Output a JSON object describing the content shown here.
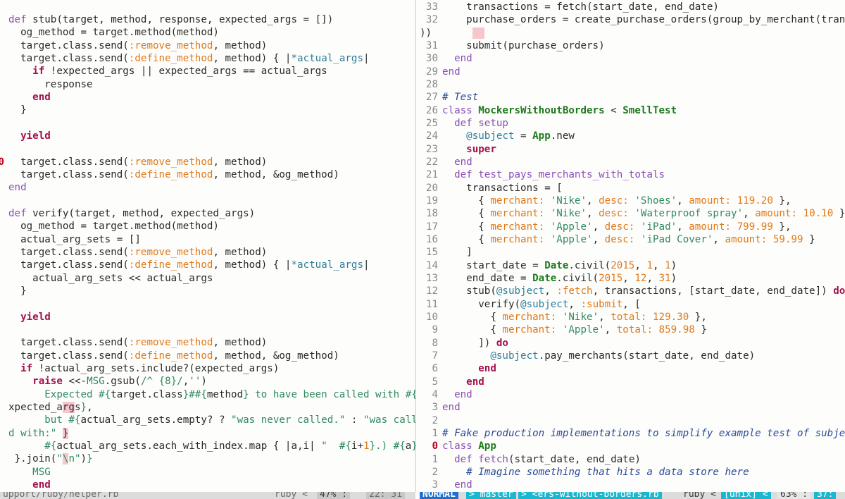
{
  "left_pane": {
    "lines": [
      {
        "n": "",
        "c": "<span class=\"kw\">def</span> stub(target, method, response, expected_args = [])"
      },
      {
        "n": "",
        "c": "  og_method = target.method(method)"
      },
      {
        "n": "",
        "c": "  target.class.send(<span class=\"sym\">:remove_method</span>, method)"
      },
      {
        "n": "",
        "c": "  target.class.send(<span class=\"sym\">:define_method</span>, method) { |<span class=\"ivar\">*actual_args</span>|"
      },
      {
        "n": "",
        "c": "    <span class=\"kwb\">if</span> !expected_args || expected_args == actual_args"
      },
      {
        "n": "",
        "c": "      response"
      },
      {
        "n": "",
        "c": "    <span class=\"kwb\">end</span>"
      },
      {
        "n": "",
        "c": "  }"
      },
      {
        "n": "",
        "c": ""
      },
      {
        "n": "",
        "c": "  <span class=\"kwb\">yield</span>"
      },
      {
        "n": "",
        "c": ""
      },
      {
        "n": "0",
        "cur": true,
        "c": "  target.class.send(<span class=\"sym\">:remove_method</span>, method)"
      },
      {
        "n": "",
        "c": "  target.class.send(<span class=\"sym\">:define_method</span>, method, &amp;og_method)"
      },
      {
        "n": "",
        "c": "<span class=\"kw\">end</span>"
      },
      {
        "n": "",
        "c": ""
      },
      {
        "n": "",
        "c": "<span class=\"kw\">def</span> verify(target, method, expected_args)"
      },
      {
        "n": "",
        "c": "  og_method = target.method(method)"
      },
      {
        "n": "",
        "c": "  actual_arg_sets = []"
      },
      {
        "n": "",
        "c": "  target.class.send(<span class=\"sym\">:remove_method</span>, method)"
      },
      {
        "n": "",
        "c": "  target.class.send(<span class=\"sym\">:define_method</span>, method) { |<span class=\"ivar\">*actual_args</span>|"
      },
      {
        "n": "",
        "c": "    actual_arg_sets &lt;&lt; actual_args"
      },
      {
        "n": "",
        "c": "  }"
      },
      {
        "n": "",
        "c": ""
      },
      {
        "n": "",
        "c": "  <span class=\"kwb\">yield</span>"
      },
      {
        "n": "",
        "c": ""
      },
      {
        "n": "",
        "c": "  target.class.send(<span class=\"sym\">:remove_method</span>, method)"
      },
      {
        "n": "",
        "c": "  target.class.send(<span class=\"sym\">:define_method</span>, method, &amp;og_method)"
      },
      {
        "n": "",
        "c": "  <span class=\"kwb\">if</span> !actual_arg_sets.include?(expected_args)"
      },
      {
        "n": "",
        "c": "    <span class=\"kwb\">raise</span> &lt;&lt;-<span class=\"str\">MSG</span>.gsub(<span class=\"str\">/^ {8}/</span>,<span class=\"str\">''</span>)"
      },
      {
        "n": "",
        "c": "<span class=\"str\">      Expected #{</span>target.class<span class=\"str\">}##{</span>method<span class=\"str\">} to have been called with #{</span>e"
      },
      {
        "n": "",
        "c": "xpected_a<span class=\"hl\">rg</span>s<span class=\"str\">}</span>,"
      },
      {
        "n": "",
        "c": "<span class=\"str\">      but #{</span>actual_arg_sets.empty? ? <span class=\"str\">\"was never called.\"</span> : <span class=\"str\">\"was calle</span>"
      },
      {
        "n": "",
        "c": "<span class=\"str\">d with:\" </span><span class=\"hl\">}</span>"
      },
      {
        "n": "",
        "c": "<span class=\"str\">      #{</span>actual_arg_sets.each_with_index.map { |a,i| <span class=\"str\">\"  #{</span>i+<span class=\"num\">1</span><span class=\"str\">}.) #{</span>a<span class=\"str\">}\"</span>"
      },
      {
        "n": "",
        "c": " }.join(<span class=\"str\">\"</span><span class=\"hl\"><span class=\"str\">\\</span></span><span class=\"str\">n\"</span>)<span class=\"str\">}</span>"
      },
      {
        "n": "",
        "c": "<span class=\"str\">    MSG</span>"
      },
      {
        "n": "",
        "c": "    <span class=\"kwb\">end</span>"
      }
    ]
  },
  "right_pane": {
    "lines": [
      {
        "n": "33",
        "c": "    transactions = fetch(start_date, end_date)"
      },
      {
        "n": "32",
        "c": "    purchase_orders = create_purchase_orders(group_by_merchant(transact"
      },
      {
        "n": "",
        "c": "<span style=\"position:relative;left:-32px\">))</span>   <span class=\"cursorblock\">  </span>"
      },
      {
        "n": "31",
        "c": "    submit(purchase_orders)"
      },
      {
        "n": "30",
        "c": "  <span class=\"kw\">end</span>"
      },
      {
        "n": "29",
        "c": "<span class=\"kw\">end</span>"
      },
      {
        "n": "28",
        "c": ""
      },
      {
        "n": "27",
        "c": "<span class=\"com\"># Test</span>"
      },
      {
        "n": "26",
        "c": "<span class=\"kw\">class</span> <span class=\"cls\">MockersWithoutBorders</span> &lt; <span class=\"cls\">SmellTest</span>"
      },
      {
        "n": "25",
        "c": "  <span class=\"kw\">def</span> <span class=\"kw\">setup</span>"
      },
      {
        "n": "24",
        "c": "    <span class=\"ivar\">@subject</span> = <span class=\"cls\">App</span>.new"
      },
      {
        "n": "23",
        "c": "    <span class=\"kwb\">super</span>"
      },
      {
        "n": "22",
        "c": "  <span class=\"kw\">end</span>"
      },
      {
        "n": "21",
        "c": "  <span class=\"kw\">def</span> <span class=\"kw\">test_pays_merchants_with_totals</span>"
      },
      {
        "n": "20",
        "c": "    transactions = ["
      },
      {
        "n": "19",
        "c": "      { <span class=\"sym\">merchant:</span> <span class=\"str\">'Nike'</span>, <span class=\"sym\">desc:</span> <span class=\"str\">'Shoes'</span>, <span class=\"sym\">amount:</span> <span class=\"num\">119.20</span> },"
      },
      {
        "n": "18",
        "c": "      { <span class=\"sym\">merchant:</span> <span class=\"str\">'Nike'</span>, <span class=\"sym\">desc:</span> <span class=\"str\">'Waterproof spray'</span>, <span class=\"sym\">amount:</span> <span class=\"num\">10.10</span> },"
      },
      {
        "n": "17",
        "c": "      { <span class=\"sym\">merchant:</span> <span class=\"str\">'Apple'</span>, <span class=\"sym\">desc:</span> <span class=\"str\">'iPad'</span>, <span class=\"sym\">amount:</span> <span class=\"num\">799.99</span> },"
      },
      {
        "n": "16",
        "c": "      { <span class=\"sym\">merchant:</span> <span class=\"str\">'Apple'</span>, <span class=\"sym\">desc:</span> <span class=\"str\">'iPad Cover'</span>, <span class=\"sym\">amount:</span> <span class=\"num\">59.99</span> }"
      },
      {
        "n": "15",
        "c": "    ]"
      },
      {
        "n": "14",
        "c": "    start_date = <span class=\"cls\">Date</span>.civil(<span class=\"num\">2015</span>, <span class=\"num\">1</span>, <span class=\"num\">1</span>)"
      },
      {
        "n": "13",
        "c": "    end_date = <span class=\"cls\">Date</span>.civil(<span class=\"num\">2015</span>, <span class=\"num\">12</span>, <span class=\"num\">31</span>)"
      },
      {
        "n": "12",
        "c": "    stub(<span class=\"ivar\">@subject</span>, <span class=\"sym\">:fetch</span>, transactions, [start_date, end_date]) <span class=\"kwb\">do</span>"
      },
      {
        "n": "11",
        "c": "      verify(<span class=\"ivar\">@subject</span>, <span class=\"sym\">:submit</span>, ["
      },
      {
        "n": "10",
        "c": "        { <span class=\"sym\">merchant:</span> <span class=\"str\">'Nike'</span>, <span class=\"sym\">total:</span> <span class=\"num\">129.30</span> },"
      },
      {
        "n": "9",
        "c": "        { <span class=\"sym\">merchant:</span> <span class=\"str\">'Apple'</span>, <span class=\"sym\">total:</span> <span class=\"num\">859.98</span> }"
      },
      {
        "n": "8",
        "c": "      ]) <span class=\"kwb\">do</span>"
      },
      {
        "n": "7",
        "c": "        <span class=\"ivar\">@subject</span>.pay_merchants(start_date, end_date)"
      },
      {
        "n": "6",
        "c": "      <span class=\"kwb\">end</span>"
      },
      {
        "n": "5",
        "c": "    <span class=\"kwb\">end</span>"
      },
      {
        "n": "4",
        "c": "  <span class=\"kw\">end</span>"
      },
      {
        "n": "3",
        "c": "<span class=\"kw\">end</span>"
      },
      {
        "n": "2",
        "c": ""
      },
      {
        "n": "1",
        "c": "<span class=\"com\"># Fake production implementations to simplify example test of subject</span>"
      },
      {
        "n": "0",
        "cur": true,
        "c": "<span class=\"kw\">class</span> <span class=\"cls\">App</span>"
      },
      {
        "n": "1",
        "c": "  <span class=\"kw\">def</span> <span class=\"kw\">fetch</span>(start_date, end_date)"
      },
      {
        "n": "2",
        "c": "    <span class=\"com\"># Imagine something that hits a data store here</span>"
      },
      {
        "n": "3",
        "c": "  <span class=\"kw\">end</span>"
      }
    ]
  },
  "left_status": {
    "file": "upport/ruby/helper.rb",
    "filetype": "ruby <",
    "percent": "47% :",
    "position": "22: 31"
  },
  "right_status": {
    "mode": "NORMAL",
    "branch": "> master",
    "file": "> <ers-without-borders.rb",
    "filetype": "ruby <",
    "encoding": "[unix] <",
    "percent": "63% :",
    "position": "37:"
  }
}
